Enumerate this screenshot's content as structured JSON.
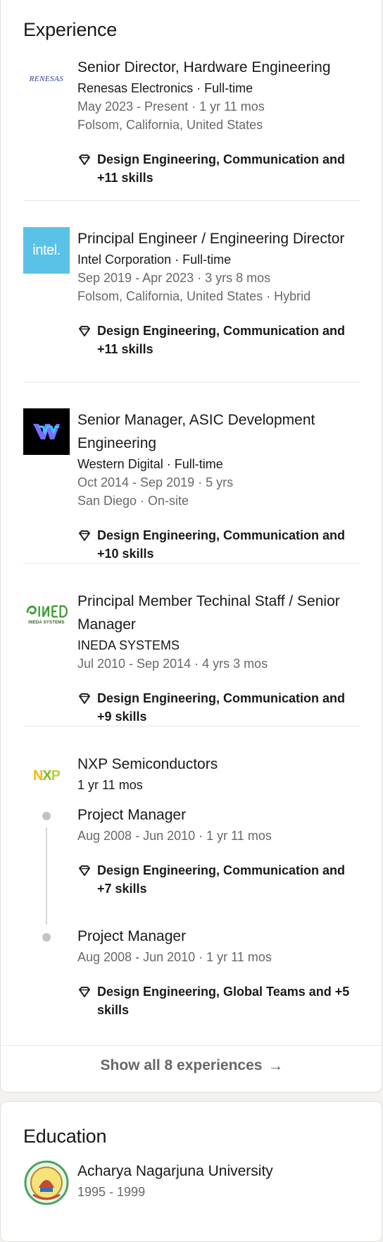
{
  "experience": {
    "heading": "Experience",
    "entries": [
      {
        "title": "Senior Director, Hardware Engineering",
        "company_line": "Renesas Electronics · Full-time",
        "dates": "May 2023 - Present · 1 yr 11 mos",
        "location": "Folsom, California, United States",
        "skills": "Design Engineering, Communication and +11 skills",
        "logo_text": "RENESAS"
      },
      {
        "title": "Principal Engineer / Engineering Director",
        "company_line": "Intel Corporation · Full-time",
        "dates": "Sep 2019 - Apr 2023 · 3 yrs 8 mos",
        "location": "Folsom, California, United States · Hybrid",
        "skills": "Design Engineering, Communication and +11 skills",
        "logo_text": "intel."
      },
      {
        "title": "Senior Manager, ASIC Development Engineering",
        "company_line": "Western Digital · Full-time",
        "dates": "Oct 2014 - Sep 2019 · 5 yrs",
        "location": "San Diego · On-site",
        "skills": "Design Engineering, Communication and +10 skills"
      },
      {
        "title": "Principal Member Techinal Staff / Senior Manager",
        "company_line": "INEDA SYSTEMS",
        "dates": "Jul 2010 - Sep 2014 · 4 yrs 3 mos",
        "skills": "Design Engineering, Communication and +9 skills",
        "logo_text": "INEDA SYSTEMS"
      }
    ],
    "group": {
      "company": "NXP Semiconductors",
      "duration": "1 yr 11 mos",
      "logo_text": "NXP",
      "roles": [
        {
          "title": "Project Manager",
          "dates": "Aug 2008 - Jun 2010 · 1 yr 11 mos",
          "skills": "Design Engineering, Communication and +7 skills"
        },
        {
          "title": "Project Manager",
          "dates": "Aug 2008 - Jun 2010 · 1 yr 11 mos",
          "skills": "Design Engineering, Global Teams and +5 skills"
        }
      ]
    },
    "show_all_label": "Show all 8 experiences",
    "show_all_icon": "arrow-right-icon"
  },
  "education": {
    "heading": "Education",
    "entries": [
      {
        "school": "Acharya Nagarjuna University",
        "dates": "1995 - 1999"
      }
    ]
  },
  "colors": {
    "intel_blue": "#5bc2e7",
    "renesas_blue": "#2a3b8f",
    "nxp_yellow": "#f9b500",
    "nxp_green": "#7bb928",
    "ineda_green": "#3f9c35"
  }
}
